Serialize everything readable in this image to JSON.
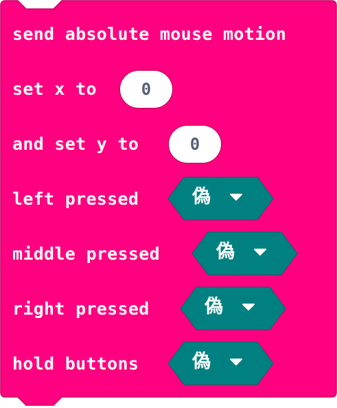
{
  "block": {
    "color": "#ff0080",
    "title": "send absolute mouse motion",
    "x_label": "set x to",
    "x_value": "0",
    "y_label": "and set y to",
    "y_value": "0",
    "left_label": "left pressed",
    "left_value": "偽",
    "middle_label": "middle pressed",
    "middle_value": "偽",
    "right_label": "right pressed",
    "right_value": "偽",
    "hold_label": "hold buttons",
    "hold_value": "偽",
    "dropdown_color": "#008080",
    "dropdown_icon": "chevron-down-icon"
  }
}
